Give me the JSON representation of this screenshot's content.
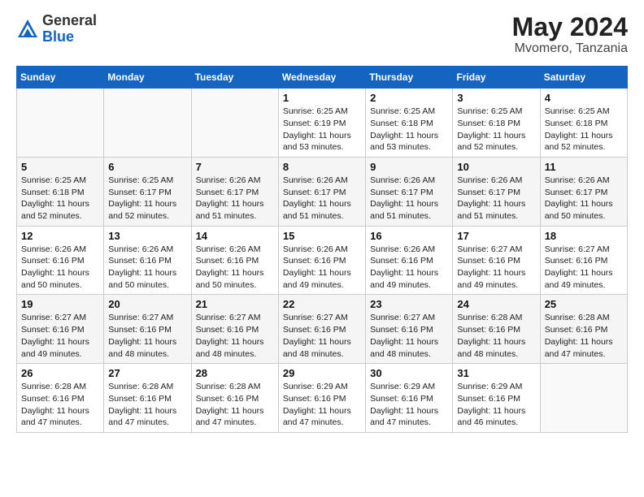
{
  "header": {
    "logo_general": "General",
    "logo_blue": "Blue",
    "month_title": "May 2024",
    "location": "Mvomero, Tanzania"
  },
  "days_of_week": [
    "Sunday",
    "Monday",
    "Tuesday",
    "Wednesday",
    "Thursday",
    "Friday",
    "Saturday"
  ],
  "weeks": [
    [
      {
        "day": "",
        "info": ""
      },
      {
        "day": "",
        "info": ""
      },
      {
        "day": "",
        "info": ""
      },
      {
        "day": "1",
        "info": "Sunrise: 6:25 AM\nSunset: 6:19 PM\nDaylight: 11 hours\nand 53 minutes."
      },
      {
        "day": "2",
        "info": "Sunrise: 6:25 AM\nSunset: 6:18 PM\nDaylight: 11 hours\nand 53 minutes."
      },
      {
        "day": "3",
        "info": "Sunrise: 6:25 AM\nSunset: 6:18 PM\nDaylight: 11 hours\nand 52 minutes."
      },
      {
        "day": "4",
        "info": "Sunrise: 6:25 AM\nSunset: 6:18 PM\nDaylight: 11 hours\nand 52 minutes."
      }
    ],
    [
      {
        "day": "5",
        "info": "Sunrise: 6:25 AM\nSunset: 6:18 PM\nDaylight: 11 hours\nand 52 minutes."
      },
      {
        "day": "6",
        "info": "Sunrise: 6:25 AM\nSunset: 6:17 PM\nDaylight: 11 hours\nand 52 minutes."
      },
      {
        "day": "7",
        "info": "Sunrise: 6:26 AM\nSunset: 6:17 PM\nDaylight: 11 hours\nand 51 minutes."
      },
      {
        "day": "8",
        "info": "Sunrise: 6:26 AM\nSunset: 6:17 PM\nDaylight: 11 hours\nand 51 minutes."
      },
      {
        "day": "9",
        "info": "Sunrise: 6:26 AM\nSunset: 6:17 PM\nDaylight: 11 hours\nand 51 minutes."
      },
      {
        "day": "10",
        "info": "Sunrise: 6:26 AM\nSunset: 6:17 PM\nDaylight: 11 hours\nand 51 minutes."
      },
      {
        "day": "11",
        "info": "Sunrise: 6:26 AM\nSunset: 6:17 PM\nDaylight: 11 hours\nand 50 minutes."
      }
    ],
    [
      {
        "day": "12",
        "info": "Sunrise: 6:26 AM\nSunset: 6:16 PM\nDaylight: 11 hours\nand 50 minutes."
      },
      {
        "day": "13",
        "info": "Sunrise: 6:26 AM\nSunset: 6:16 PM\nDaylight: 11 hours\nand 50 minutes."
      },
      {
        "day": "14",
        "info": "Sunrise: 6:26 AM\nSunset: 6:16 PM\nDaylight: 11 hours\nand 50 minutes."
      },
      {
        "day": "15",
        "info": "Sunrise: 6:26 AM\nSunset: 6:16 PM\nDaylight: 11 hours\nand 49 minutes."
      },
      {
        "day": "16",
        "info": "Sunrise: 6:26 AM\nSunset: 6:16 PM\nDaylight: 11 hours\nand 49 minutes."
      },
      {
        "day": "17",
        "info": "Sunrise: 6:27 AM\nSunset: 6:16 PM\nDaylight: 11 hours\nand 49 minutes."
      },
      {
        "day": "18",
        "info": "Sunrise: 6:27 AM\nSunset: 6:16 PM\nDaylight: 11 hours\nand 49 minutes."
      }
    ],
    [
      {
        "day": "19",
        "info": "Sunrise: 6:27 AM\nSunset: 6:16 PM\nDaylight: 11 hours\nand 49 minutes."
      },
      {
        "day": "20",
        "info": "Sunrise: 6:27 AM\nSunset: 6:16 PM\nDaylight: 11 hours\nand 48 minutes."
      },
      {
        "day": "21",
        "info": "Sunrise: 6:27 AM\nSunset: 6:16 PM\nDaylight: 11 hours\nand 48 minutes."
      },
      {
        "day": "22",
        "info": "Sunrise: 6:27 AM\nSunset: 6:16 PM\nDaylight: 11 hours\nand 48 minutes."
      },
      {
        "day": "23",
        "info": "Sunrise: 6:27 AM\nSunset: 6:16 PM\nDaylight: 11 hours\nand 48 minutes."
      },
      {
        "day": "24",
        "info": "Sunrise: 6:28 AM\nSunset: 6:16 PM\nDaylight: 11 hours\nand 48 minutes."
      },
      {
        "day": "25",
        "info": "Sunrise: 6:28 AM\nSunset: 6:16 PM\nDaylight: 11 hours\nand 47 minutes."
      }
    ],
    [
      {
        "day": "26",
        "info": "Sunrise: 6:28 AM\nSunset: 6:16 PM\nDaylight: 11 hours\nand 47 minutes."
      },
      {
        "day": "27",
        "info": "Sunrise: 6:28 AM\nSunset: 6:16 PM\nDaylight: 11 hours\nand 47 minutes."
      },
      {
        "day": "28",
        "info": "Sunrise: 6:28 AM\nSunset: 6:16 PM\nDaylight: 11 hours\nand 47 minutes."
      },
      {
        "day": "29",
        "info": "Sunrise: 6:29 AM\nSunset: 6:16 PM\nDaylight: 11 hours\nand 47 minutes."
      },
      {
        "day": "30",
        "info": "Sunrise: 6:29 AM\nSunset: 6:16 PM\nDaylight: 11 hours\nand 47 minutes."
      },
      {
        "day": "31",
        "info": "Sunrise: 6:29 AM\nSunset: 6:16 PM\nDaylight: 11 hours\nand 46 minutes."
      },
      {
        "day": "",
        "info": ""
      }
    ]
  ]
}
